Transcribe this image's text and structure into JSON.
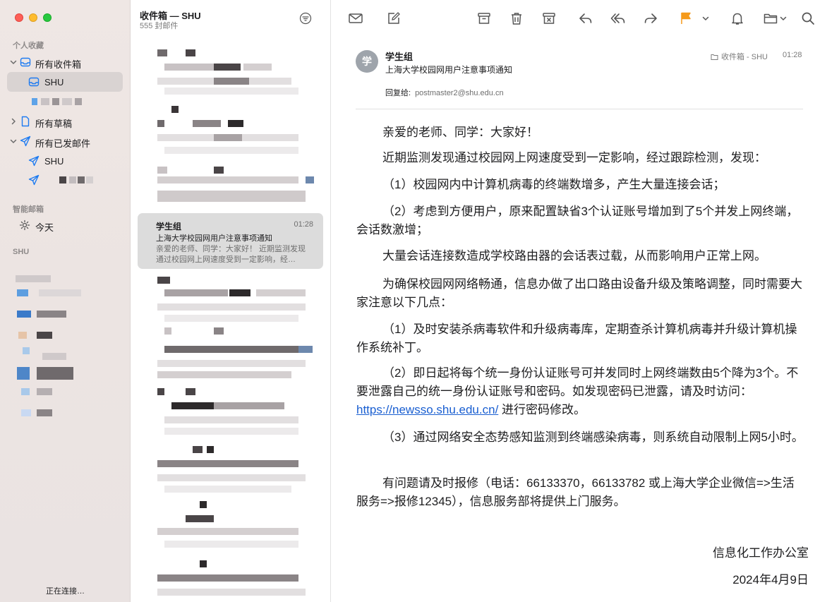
{
  "sidebar": {
    "favorites_label": "个人收藏",
    "all_inboxes": "所有收件箱",
    "shu_inbox": "SHU",
    "all_drafts": "所有草稿",
    "all_sent": "所有已发邮件",
    "sent_shu": "SHU",
    "smart_label": "智能邮箱",
    "today": "今天",
    "shu_section": "SHU",
    "status": "正在连接…"
  },
  "list": {
    "title": "收件箱 — SHU",
    "count": "555 封邮件",
    "selected": {
      "sender": "学生组",
      "time": "01:28",
      "subject": "上海大学校园网用户注意事项通知",
      "preview": "亲爱的老师、同学：大家好！ 近期监测发现通过校园网上网速度受到一定影响，经…"
    }
  },
  "toolbar": {
    "icons": [
      "envelope-icon",
      "compose-icon",
      "archive-icon",
      "trash-icon",
      "junk-icon",
      "reply-icon",
      "reply-all-icon",
      "forward-icon",
      "flag-icon",
      "bell-icon",
      "folder-icon",
      "search-icon"
    ],
    "flag_color": "#f59a1b"
  },
  "message": {
    "avatar": "学",
    "sender": "学生组",
    "subject": "上海大学校园网用户注意事项通知",
    "folder": "收件箱 - SHU",
    "time": "01:28",
    "reply_to_label": "回复给:",
    "reply_to": "postmaster2@shu.edu.cn",
    "greeting": "亲爱的老师、同学：大家好！",
    "p1": "近期监测发现通过校园网上网速度受到一定影响，经过跟踪检测，发现：",
    "p2": "（1）校园网内中计算机病毒的终端数增多，产生大量连接会话；",
    "p3": "（2）考虑到方便用户，原来配置缺省3个认证账号增加到了5个并发上网终端，会话数激增；",
    "p4": "大量会话连接数造成学校路由器的会话表过载，从而影响用户正常上网。",
    "p5": "为确保校园网网络畅通，信息办做了出口路由设备升级及策略调整，同时需要大家注意以下几点：",
    "p6": "（1）及时安装杀病毒软件和升级病毒库，定期查杀计算机病毒并升级计算机操作系统补丁。",
    "p7_pre": "（2）即日起将每个统一身份认证账号可并发同时上网终端数由5个降为3个。不要泄露自己的统一身份认证账号和密码。如发现密码已泄露，请及时访问：",
    "p7_link": "https://newsso.shu.edu.cn/",
    "p7_post": " 进行密码修改。",
    "p8": "（3）通过网络安全态势感知监测到终端感染病毒，则系统自动限制上网5小时。",
    "p9": "有问题请及时报修（电话：66133370，66133782 或上海大学企业微信=>生活服务=>报修12345），信息服务部将提供上门服务。",
    "signature": "信息化工作办公室",
    "date": "2024年4月9日"
  }
}
